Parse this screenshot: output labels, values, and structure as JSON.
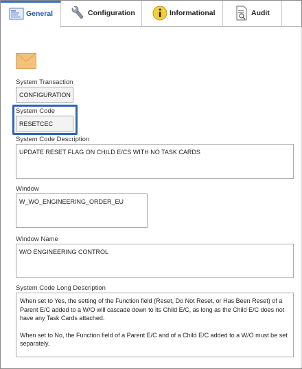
{
  "tabs": [
    {
      "label": "General",
      "icon": "general-form-icon",
      "active": true
    },
    {
      "label": "Configuration",
      "icon": "wrench-icon",
      "active": false
    },
    {
      "label": "Informational",
      "icon": "info-icon",
      "active": false
    },
    {
      "label": "Audit",
      "icon": "audit-document-icon",
      "active": false
    }
  ],
  "form": {
    "system_transaction": {
      "label": "System Transaction",
      "value": "CONFIGURATION"
    },
    "system_code": {
      "label": "System Code",
      "value": "RESETCEC"
    },
    "system_code_description": {
      "label": "System Code Description",
      "value": "UPDATE RESET FLAG ON CHILD E/CS WITH NO TASK CARDS"
    },
    "window": {
      "label": "Window",
      "value": "W_WO_ENGINEERING_ORDER_EU"
    },
    "window_name": {
      "label": "Window Name",
      "value": "W/O ENGINEERING CONTROL"
    },
    "long_description": {
      "label": "System Code Long Description",
      "para1": "When set to Yes, the setting of the Function field (Reset, Do Not Reset, or Has Been Reset) of a Parent E/C added to a W/O will cascade down to its Child E/C, as long as the Child E/C does not have any Task Cards attached.",
      "para2": "When set to No, the Function field of a Parent E/C and of a Child E/C added to a W/O must be set separately."
    }
  },
  "colors": {
    "active_tab_text": "#1f5aa6",
    "highlight_border": "#2e63b8",
    "envelope": "#f2c27a"
  }
}
